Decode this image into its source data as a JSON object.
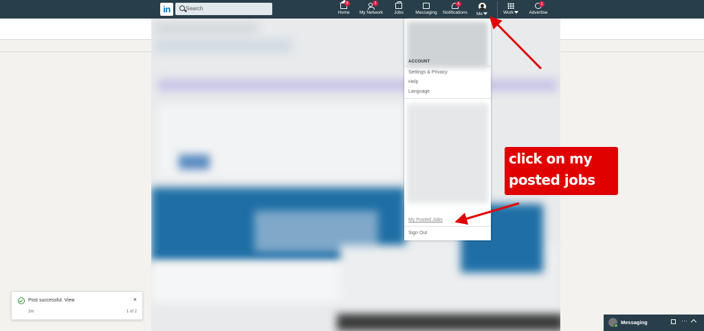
{
  "nav": {
    "search_placeholder": "Search",
    "items": [
      {
        "label": "Home",
        "badge": "9"
      },
      {
        "label": "My Network",
        "badge": "2"
      },
      {
        "label": "Jobs",
        "badge": ""
      },
      {
        "label": "Messaging",
        "badge": ""
      },
      {
        "label": "Notifications",
        "badge": "6"
      },
      {
        "label": "Me",
        "badge": ""
      },
      {
        "label": "Work",
        "badge": ""
      },
      {
        "label": "Advertise",
        "badge": "1"
      }
    ]
  },
  "dropdown": {
    "section": "ACCOUNT",
    "items": [
      "Settings & Privacy",
      "Help",
      "Language"
    ],
    "posted_jobs": "My Posted Jobs",
    "sign_out": "Sign Out"
  },
  "annotation": {
    "line1": "click on my",
    "line2": "posted jobs",
    "color": "#e10000"
  },
  "toast": {
    "message": "Post successful. View",
    "time": "2m",
    "pager": "1 of 2",
    "close": "×"
  },
  "messaging": {
    "title": "Messaging"
  }
}
